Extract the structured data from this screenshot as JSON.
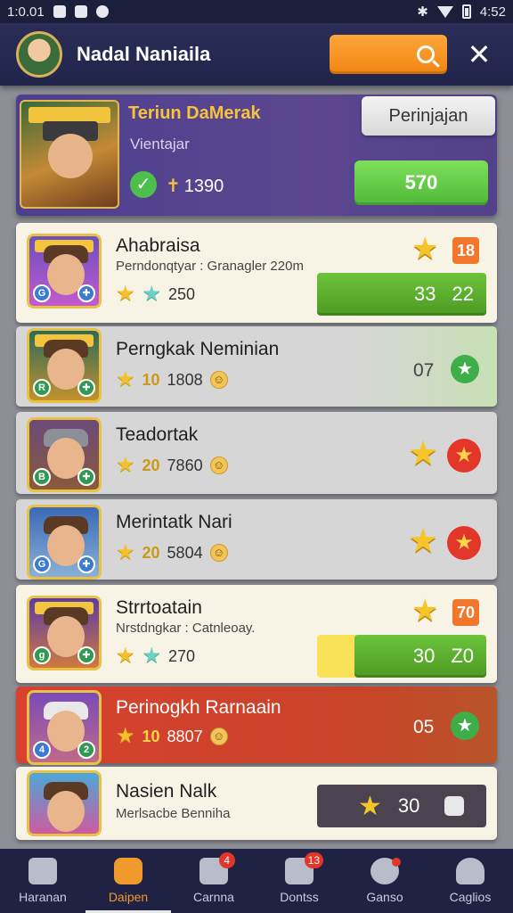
{
  "status_bar": {
    "time_left": "1:0.01",
    "time_right": "4:52"
  },
  "header": {
    "title": "Nadal Naniaila"
  },
  "featured": {
    "title": "Teriun DaMerak",
    "subtitle": "Vientajar",
    "score": "1390",
    "button_top": "Perinjajan",
    "button_bottom": "570"
  },
  "items": [
    {
      "title": "Ahabraisa",
      "subtitle": "Perndonqtyar : Granagler 220m",
      "score": "250",
      "badge": "18",
      "bar_a": "33",
      "bar_b": "22"
    },
    {
      "title": "Perngkak Neminian",
      "level": "10",
      "score": "1808",
      "right_value": "07"
    },
    {
      "title": "Teadortak",
      "level": "20",
      "score": "7860"
    },
    {
      "title": "Merintatk Nari",
      "level": "20",
      "score": "5804"
    },
    {
      "title": "Strrtoatain",
      "subtitle": "Nrstdngkar : Catnleoay.",
      "score": "270",
      "badge": "70",
      "bar_a": "30",
      "bar_b": "Z0"
    },
    {
      "title": "Perinogkh Rarnaain",
      "level": "10",
      "score": "8807",
      "right_value": "05"
    },
    {
      "title": "Nasien Nalk",
      "subtitle": "Merlsacbe Benniha",
      "bar_value": "30"
    }
  ],
  "nav": [
    {
      "label": "Haranan",
      "icon": "home-icon"
    },
    {
      "label": "Daipen",
      "icon": "shop-icon",
      "active": true
    },
    {
      "label": "Carnna",
      "icon": "game-icon",
      "badge": "4"
    },
    {
      "label": "Dontss",
      "icon": "mail-icon",
      "badge": "13"
    },
    {
      "label": "Ganso",
      "icon": "ball-icon"
    },
    {
      "label": "Caglios",
      "icon": "profile-icon"
    }
  ]
}
